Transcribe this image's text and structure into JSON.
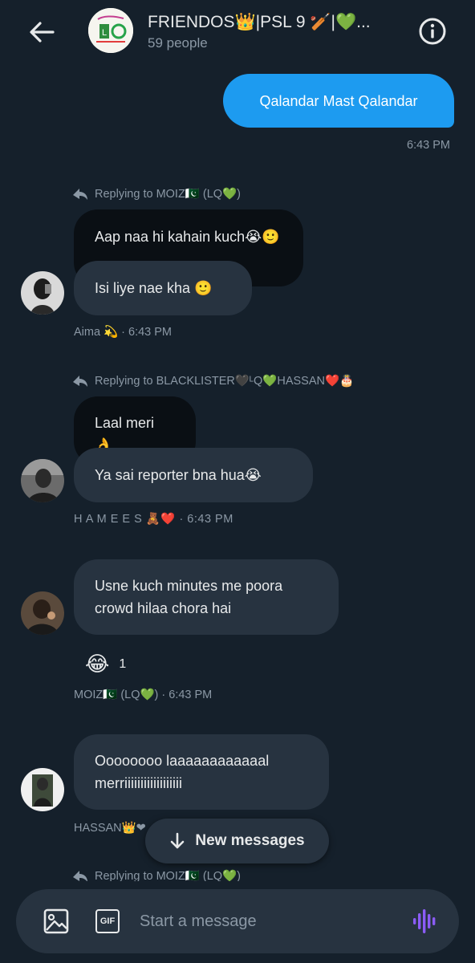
{
  "header": {
    "title": "FRIENDOS👑|PSL 9 🏏|💚...",
    "subtitle": "59 people",
    "back_icon": "arrow-left-icon",
    "info_icon": "info-circle-icon"
  },
  "messages": [
    {
      "type": "sent",
      "text": "Qalandar Mast Qalandar",
      "time": "6:43 PM"
    },
    {
      "type": "reply",
      "replying_to": "Replying to MOIZ🇵🇰 (LQ💚)",
      "quoted": "Aap naa hi kahain kuch😭🙂",
      "text": "Isi liye nae kha 🙂",
      "meta": "Aima 💫 · 6:43 PM"
    },
    {
      "type": "reply",
      "replying_to": "Replying to BLACKLISTER🖤ᴸQ💚HASSAN❤️🎂",
      "quoted": "Laal meri 👌",
      "text": "Ya sai reporter bna hua😭",
      "meta": "H A M E E S 🧸❤️ · 6:43 PM"
    },
    {
      "type": "received",
      "text_line1": "Usne kuch minutes me poora",
      "text_line2": "crowd hilaa chora hai",
      "reaction_emoji": "😂",
      "reaction_count": "1",
      "meta": "MOIZ🇵🇰 (LQ💚) · 6:43 PM"
    },
    {
      "type": "received",
      "text_line1": "Oooooooo laaaaaaaaaaaal",
      "text_line2": "merriiiiiiiiiiiiiiiiii",
      "meta": "HASSAN👑❤"
    },
    {
      "type": "reply-partial",
      "replying_to": "Replying to MOIZ🇵🇰 (LQ💚)"
    }
  ],
  "new_messages_label": "New messages",
  "composer": {
    "placeholder": "Start a message",
    "gif_label": "GIF",
    "image_icon": "image-icon",
    "voice_icon": "voice-wave-icon"
  },
  "colors": {
    "background": "#15202b",
    "sent_bubble": "#1d9bf0",
    "received_bubble": "#273340",
    "accent_voice": "#8b5cf6"
  }
}
